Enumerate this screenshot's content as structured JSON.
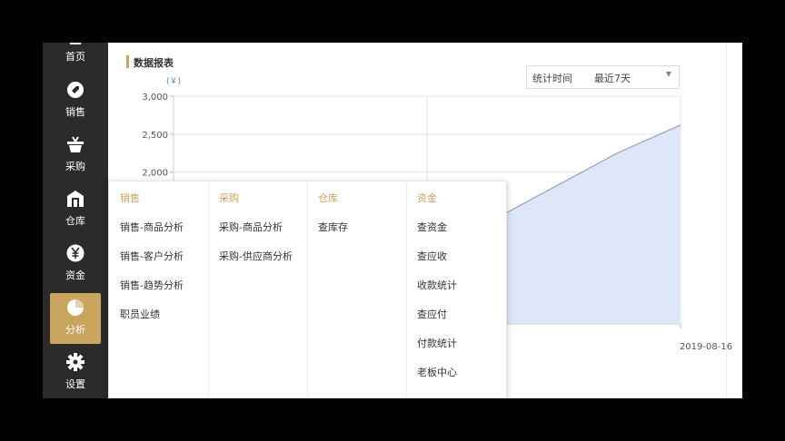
{
  "sidebar": {
    "items": [
      {
        "label": "首页",
        "icon": "home-icon"
      },
      {
        "label": "销售",
        "icon": "sales-tag-icon"
      },
      {
        "label": "采购",
        "icon": "basket-icon"
      },
      {
        "label": "仓库",
        "icon": "warehouse-icon"
      },
      {
        "label": "资金",
        "icon": "yen-coin-icon"
      },
      {
        "label": "分析",
        "icon": "pie-chart-icon"
      },
      {
        "label": "设置",
        "icon": "gear-icon"
      }
    ],
    "active_index": 5,
    "active_color": "#c9a45c",
    "background": "#2b2b2b"
  },
  "report": {
    "title": "数据报表",
    "time_filter": {
      "label": "统计时间",
      "selected": "最近7天"
    }
  },
  "chart_data": {
    "type": "area",
    "unit_label": "(￥)",
    "y_ticks": [
      "3,000",
      "2,500",
      "2,000"
    ],
    "ylim": [
      0,
      3000
    ],
    "x_tick_labels": [
      "2019-08-16"
    ],
    "series": [
      {
        "values": [
          0,
          0,
          200,
          500,
          900,
          1350,
          1800,
          2250,
          2620
        ]
      }
    ],
    "fill_color": "#dde7f7",
    "line_color": "#9b9bc9",
    "grid": true
  },
  "menu": {
    "columns": [
      {
        "header": "销售",
        "items": [
          "销售-商品分析",
          "销售-客户分析",
          "销售-趋势分析",
          "职员业绩"
        ]
      },
      {
        "header": "采购",
        "items": [
          "采购-商品分析",
          "采购-供应商分析"
        ]
      },
      {
        "header": "仓库",
        "items": [
          "查库存"
        ]
      },
      {
        "header": "资金",
        "items": [
          "查资金",
          "查应收",
          "收款统计",
          "查应付",
          "付款统计",
          "老板中心"
        ]
      }
    ]
  }
}
